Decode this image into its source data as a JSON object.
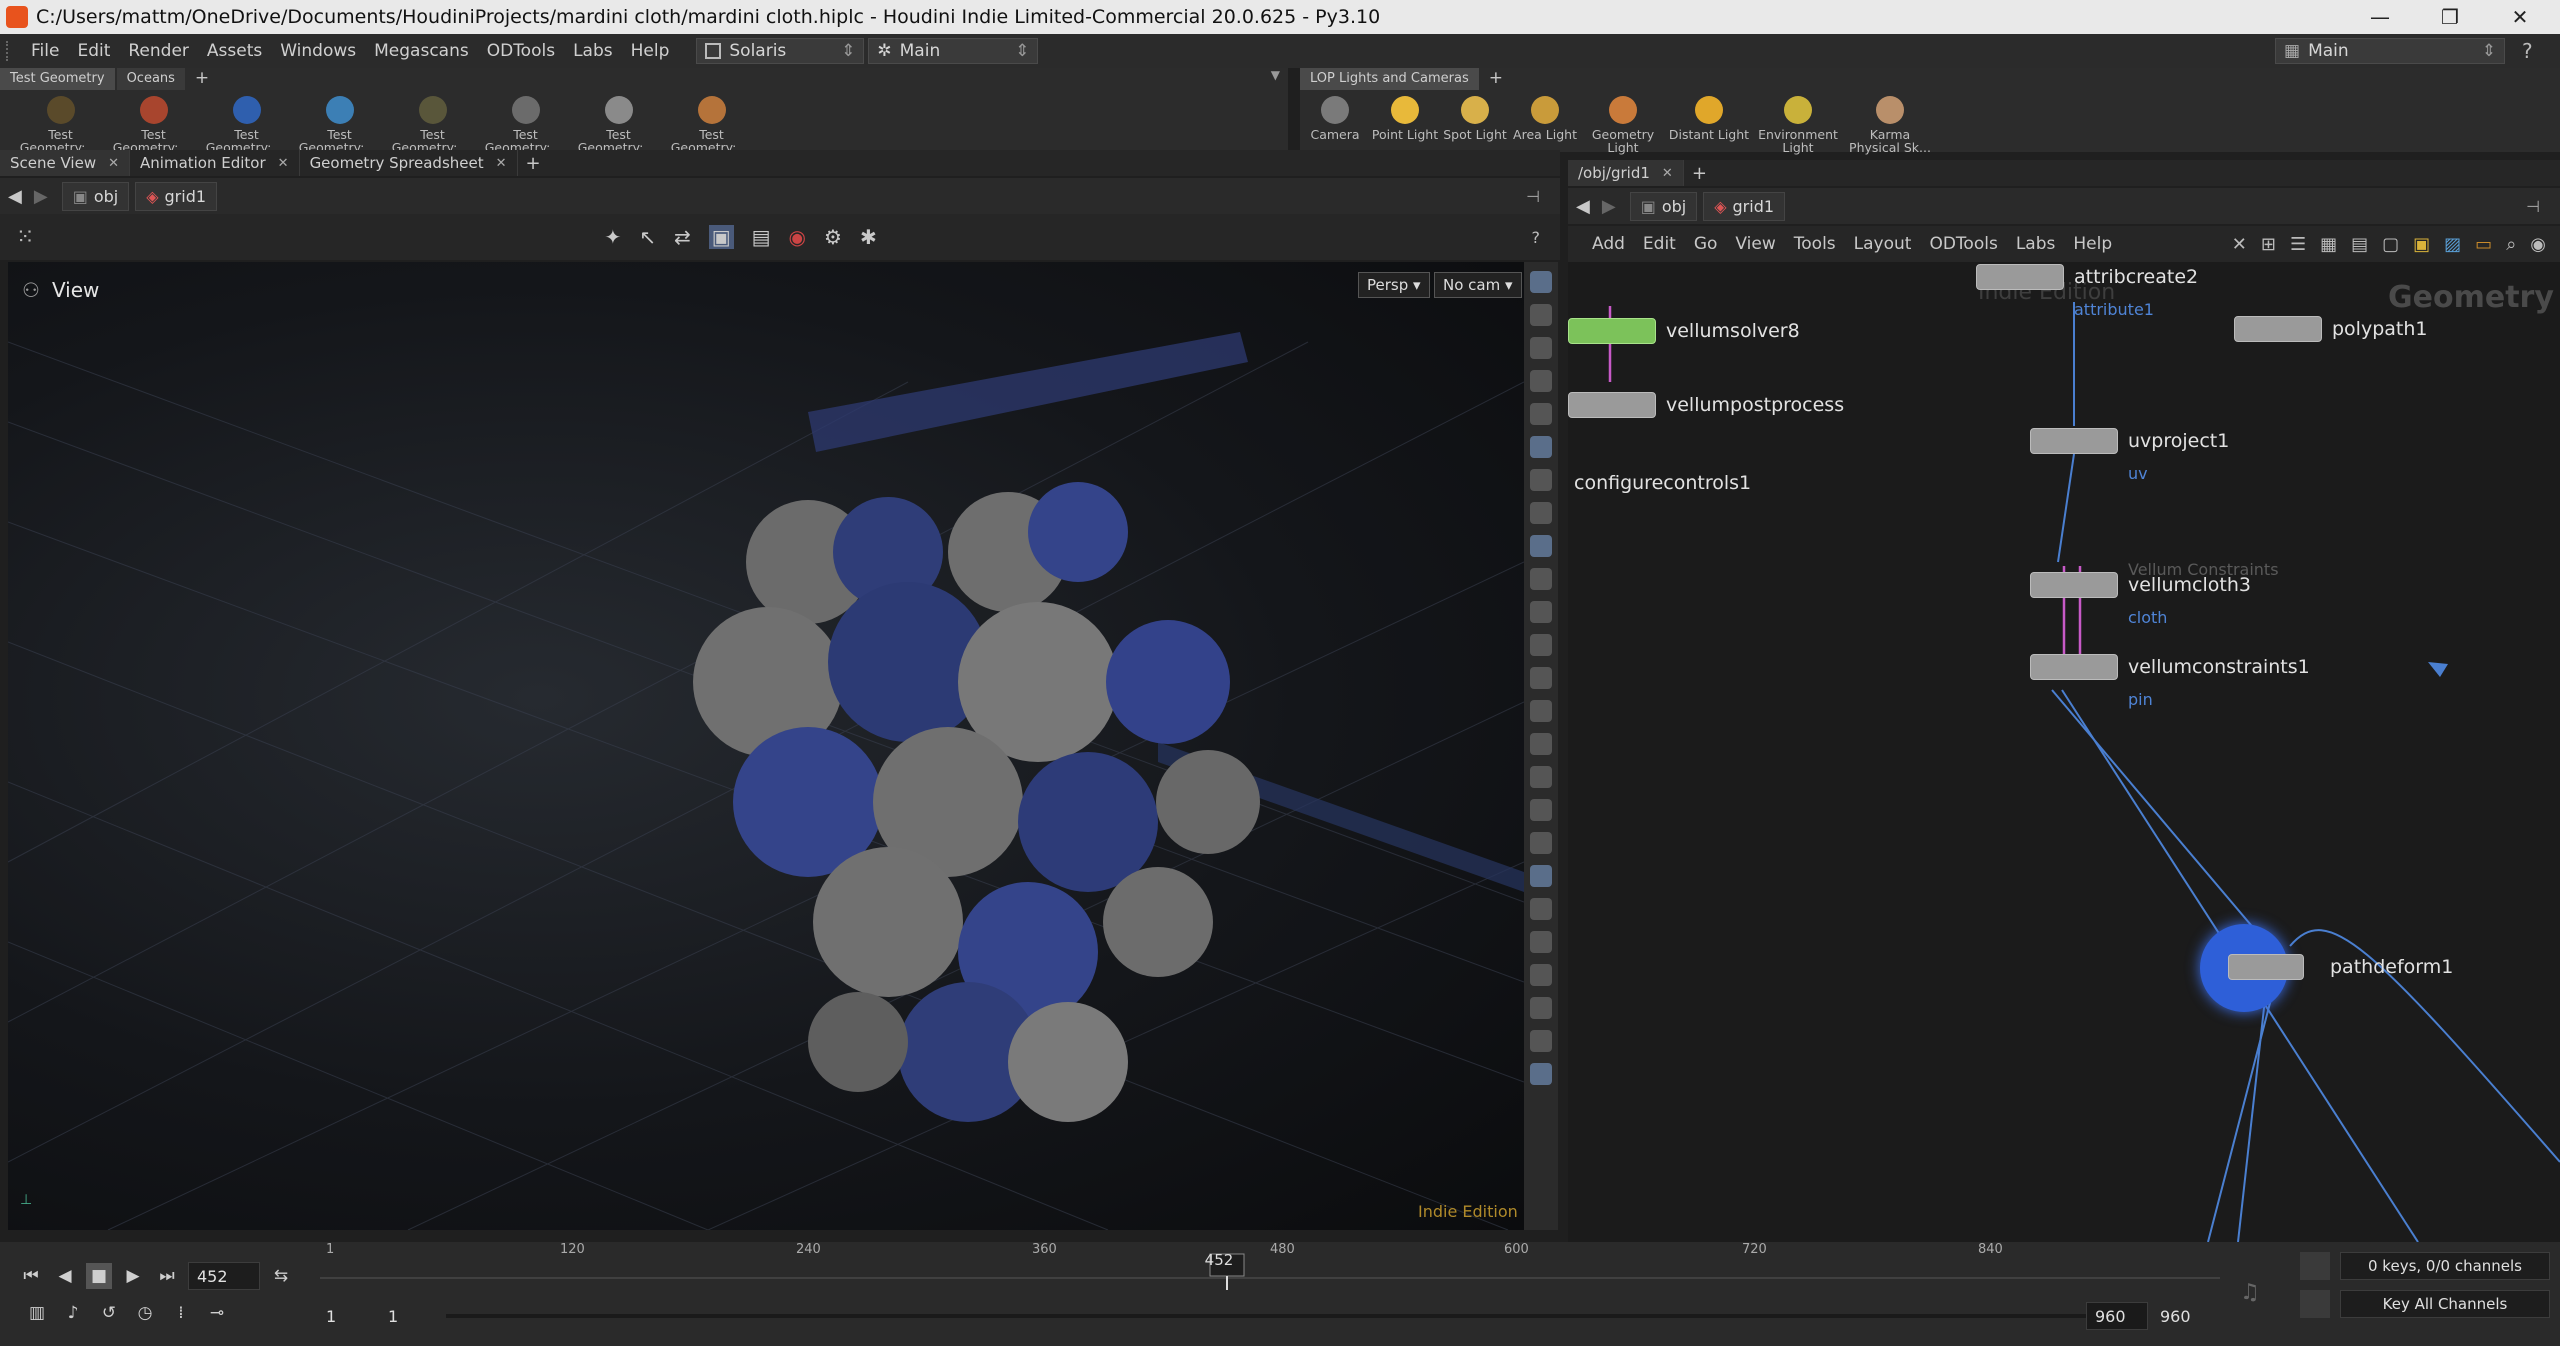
{
  "titlebar": {
    "title": "C:/Users/mattm/OneDrive/Documents/HoudiniProjects/mardini cloth/mardini cloth.hiplc - Houdini Indie Limited-Commercial 20.0.625 - Py3.10",
    "minimize": "—",
    "maximize": "❐",
    "close": "✕"
  },
  "menubar": {
    "items": [
      "File",
      "Edit",
      "Render",
      "Assets",
      "Windows",
      "Megascans",
      "ODTools",
      "Labs",
      "Help"
    ],
    "desktop": "Solaris",
    "context": "Main",
    "right_desktop": "Main"
  },
  "shelf_left": {
    "tabs": [
      "Test Geometry",
      "Oceans"
    ],
    "add": "+",
    "tools": [
      {
        "label": "Test Geometry: ...",
        "color": "#5a4a2a"
      },
      {
        "label": "Test Geometry: ...",
        "color": "#a8452e"
      },
      {
        "label": "Test Geometry: ...",
        "color": "#2f5fae"
      },
      {
        "label": "Test Geometry: ...",
        "color": "#3c7fb5"
      },
      {
        "label": "Test Geometry: ...",
        "color": "#59563a"
      },
      {
        "label": "Test Geometry: ...",
        "color": "#6b6b6b"
      },
      {
        "label": "Test Geometry: ...",
        "color": "#8a8a8a"
      },
      {
        "label": "Test Geometry: ...",
        "color": "#b5733a"
      }
    ]
  },
  "shelf_right": {
    "tabs": [
      "LOP Lights and Cameras"
    ],
    "add": "+",
    "tools": [
      {
        "label": "Camera",
        "color": "#7a7a7a"
      },
      {
        "label": "Point Light",
        "color": "#e8b93a"
      },
      {
        "label": "Spot Light",
        "color": "#d8b04a"
      },
      {
        "label": "Area Light",
        "color": "#c99b3a"
      },
      {
        "label": "Geometry Light",
        "color": "#c97a3a"
      },
      {
        "label": "Distant Light",
        "color": "#e0a72a"
      },
      {
        "label": "Environment Light",
        "color": "#c9b13a"
      },
      {
        "label": "Karma Physical Sk...",
        "color": "#b98f6a"
      }
    ]
  },
  "left_panel": {
    "tabs": [
      "Scene View",
      "Animation Editor",
      "Geometry Spreadsheet"
    ],
    "path": [
      "obj",
      "grid1"
    ],
    "viewport": {
      "title": "View",
      "persp": "Persp ▾",
      "camera": "No cam ▾",
      "watermark": "Indie Edition"
    }
  },
  "right_panel": {
    "tab": "/obj/grid1",
    "path": [
      "obj",
      "grid1"
    ],
    "menu": [
      "Add",
      "Edit",
      "Go",
      "View",
      "Tools",
      "Layout",
      "ODTools",
      "Labs",
      "Help"
    ],
    "context_label": "Geometry",
    "watermark": "Indie Edition",
    "nodes": [
      {
        "name": "attribcreate2",
        "sub": "attribute1"
      },
      {
        "name": "polypath1",
        "sub": ""
      },
      {
        "name": "vellumsolver8",
        "sub": ""
      },
      {
        "name": "vellumpostprocess",
        "sub": ""
      },
      {
        "name": "configurecontrols1",
        "sub": ""
      },
      {
        "name": "uvproject1",
        "sub": "uv"
      },
      {
        "name": "vellumcloth3",
        "sub": "cloth",
        "header": "Vellum Constraints"
      },
      {
        "name": "vellumconstraints1",
        "sub": "pin"
      },
      {
        "name": "pathdeform1",
        "sub": ""
      }
    ]
  },
  "timeline": {
    "current_frame": "452",
    "marker": "452",
    "ticks": [
      "1",
      "120",
      "240",
      "360",
      "480",
      "600",
      "720",
      "840"
    ],
    "start": "1",
    "start2": "1",
    "end": "960",
    "end2": "960",
    "keys_info": "0 keys, 0/0 channels",
    "key_all": "Key All Channels"
  }
}
